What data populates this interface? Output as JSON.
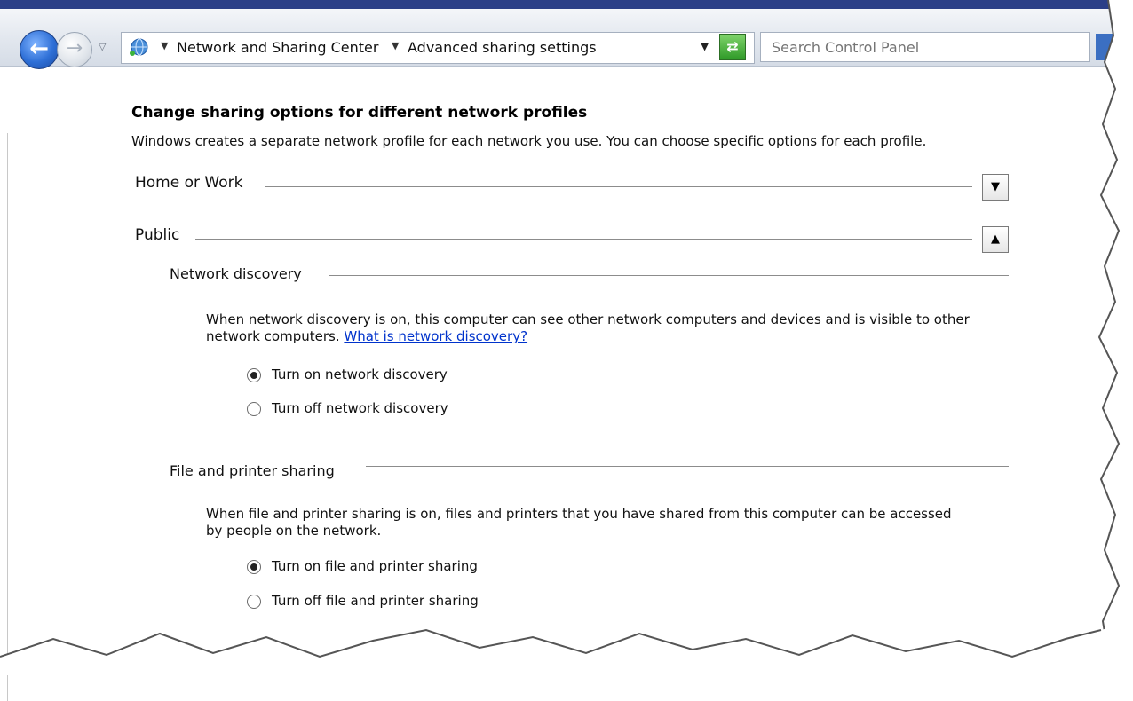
{
  "navigation": {
    "back_icon": "back-arrow-icon",
    "forward_icon": "forward-arrow-icon",
    "address": {
      "crumbs": [
        "Network and Sharing Center",
        "Advanced sharing settings"
      ]
    },
    "search": {
      "placeholder": "Search Control Panel"
    }
  },
  "page": {
    "heading": "Change sharing options for different network profiles",
    "subtext": "Windows creates a separate network profile for each network you use. You can choose specific options for each profile."
  },
  "profiles": {
    "home_work": {
      "label": "Home or Work",
      "expanded": false
    },
    "public": {
      "label": "Public",
      "expanded": true
    }
  },
  "network_discovery": {
    "title": "Network discovery",
    "description": "When network discovery is on, this computer can see other network computers and devices and is visible to other network computers.",
    "link": "What is network discovery?",
    "options": [
      {
        "label": "Turn on network discovery",
        "selected": true
      },
      {
        "label": "Turn off network discovery",
        "selected": false
      }
    ]
  },
  "file_sharing": {
    "title": "File and printer sharing",
    "description": "When file and printer sharing is on, files and printers that you have shared from this computer can be accessed by people on the network.",
    "options": [
      {
        "label": "Turn on file and printer sharing",
        "selected": true
      },
      {
        "label": "Turn off file and printer sharing",
        "selected": false
      }
    ]
  },
  "colors": {
    "link": "#0033cc",
    "title_strip": "#2b3f87",
    "rule": "#8c8c8c"
  }
}
